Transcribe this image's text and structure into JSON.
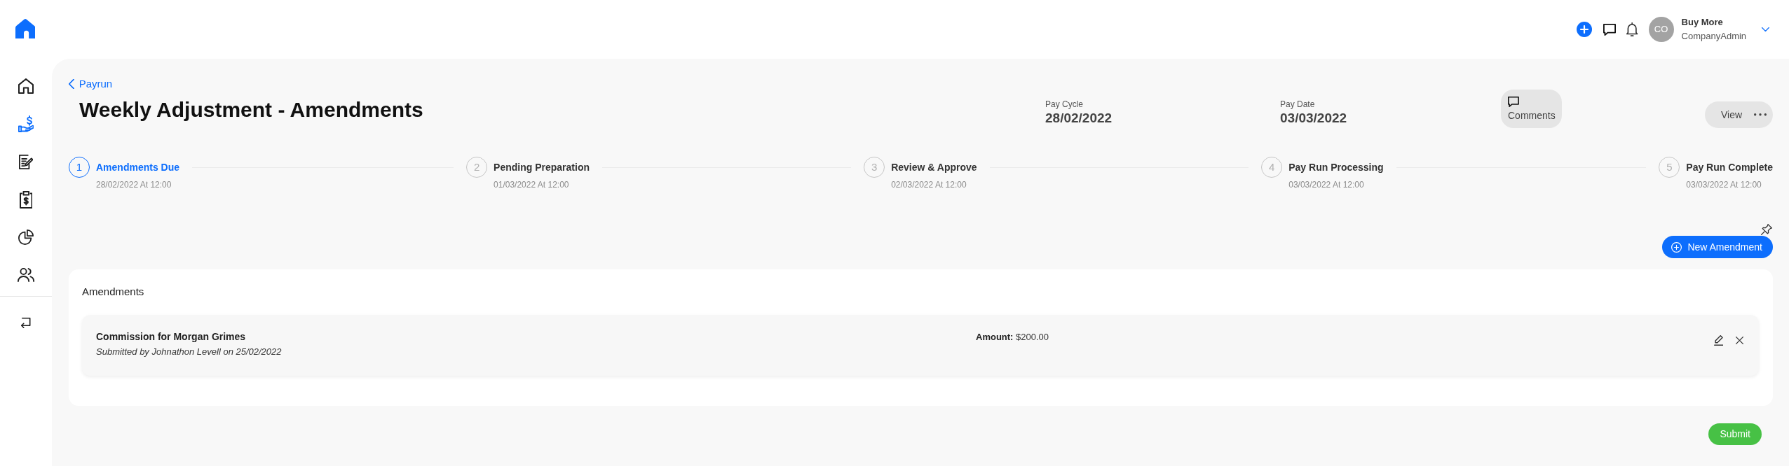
{
  "sidebar": {
    "items": [
      {
        "kind": "home",
        "selected": false
      },
      {
        "kind": "payments",
        "selected": true
      },
      {
        "kind": "documents",
        "selected": false
      },
      {
        "kind": "billing",
        "selected": false
      },
      {
        "kind": "reports",
        "selected": false
      },
      {
        "kind": "people",
        "selected": false
      }
    ]
  },
  "header": {
    "account": {
      "initials": "CO",
      "name": "Buy More",
      "role": "CompanyAdmin"
    }
  },
  "page": {
    "back_link": "Payrun",
    "title": "Weekly Adjustment - Amendments",
    "pay_cycle": {
      "label": "Pay Cycle",
      "value": "28/02/2022"
    },
    "pay_date": {
      "label": "Pay Date",
      "value": "03/03/2022"
    },
    "comments_button": "Comments",
    "view_button": "View"
  },
  "steps": [
    {
      "number": "1",
      "label": "Amendments Due",
      "date": "28/02/2022 At 12:00",
      "selected": true
    },
    {
      "number": "2",
      "label": "Pending Preparation",
      "date": "01/03/2022 At 12:00",
      "selected": false
    },
    {
      "number": "3",
      "label": "Review & Approve",
      "date": "02/03/2022 At 12:00",
      "selected": false
    },
    {
      "number": "4",
      "label": "Pay Run Processing",
      "date": "03/03/2022 At 12:00",
      "selected": false
    },
    {
      "number": "5",
      "label": "Pay Run Complete",
      "date": "03/03/2022 At 12:00",
      "selected": false
    }
  ],
  "new_amendment_button": "New Amendment",
  "amendments": {
    "title": "Amendments",
    "items": [
      {
        "title": "Commission for Morgan Grimes",
        "submitted": "Submitted by Johnathon Levell on 25/02/2022",
        "amount": "**Amount:** $200.00"
      }
    ]
  },
  "submit_button": "Submit"
}
